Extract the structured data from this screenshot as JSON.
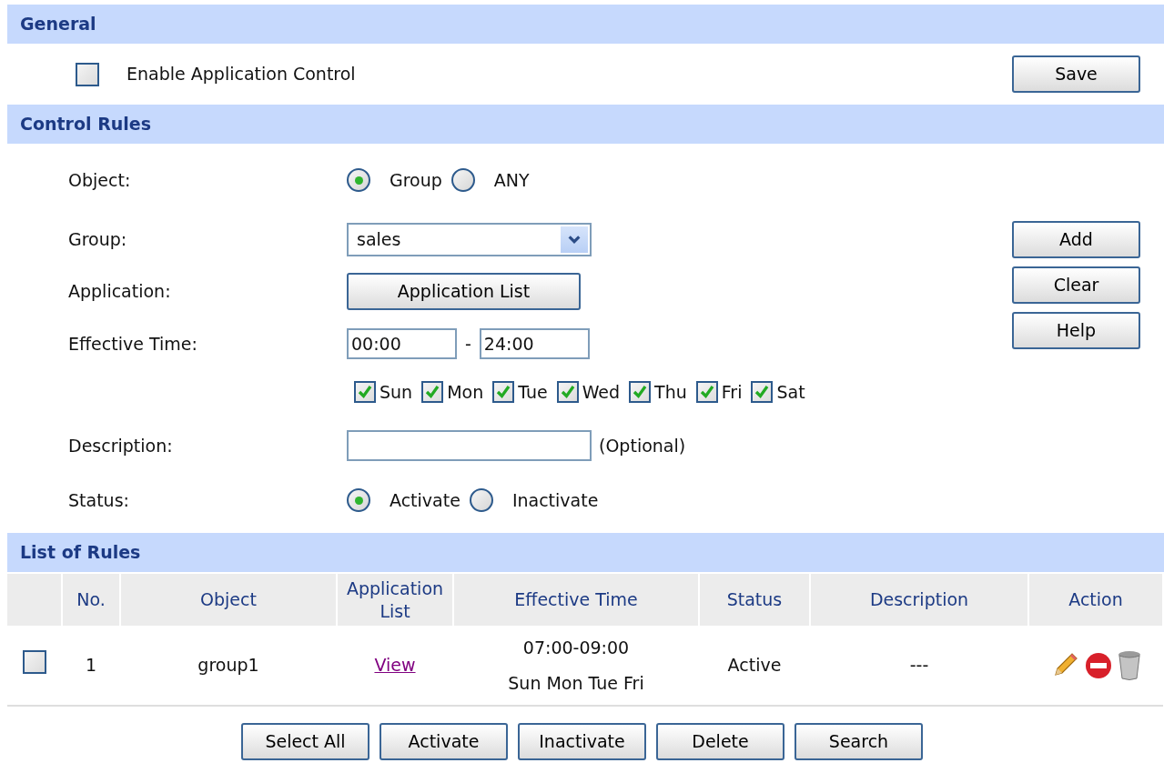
{
  "general": {
    "title": "General",
    "enable": {
      "label": "Enable Application Control",
      "checked": false
    },
    "save_button": "Save"
  },
  "control_rules": {
    "title": "Control Rules",
    "object": {
      "label": "Object:",
      "options": [
        {
          "label": "Group",
          "selected": true
        },
        {
          "label": "ANY",
          "selected": false
        }
      ]
    },
    "group": {
      "label": "Group:",
      "value": "sales"
    },
    "application": {
      "label": "Application:",
      "button": "Application List"
    },
    "effective_time": {
      "label": "Effective Time:",
      "start": "00:00",
      "separator": "-",
      "end": "24:00"
    },
    "days": [
      {
        "label": "Sun",
        "checked": true
      },
      {
        "label": "Mon",
        "checked": true
      },
      {
        "label": "Tue",
        "checked": true
      },
      {
        "label": "Wed",
        "checked": true
      },
      {
        "label": "Thu",
        "checked": true
      },
      {
        "label": "Fri",
        "checked": true
      },
      {
        "label": "Sat",
        "checked": true
      }
    ],
    "description": {
      "label": "Description:",
      "hint": "(Optional)"
    },
    "status": {
      "label": "Status:",
      "options": [
        {
          "label": "Activate",
          "selected": true
        },
        {
          "label": "Inactivate",
          "selected": false
        }
      ]
    },
    "buttons": [
      "Add",
      "Clear",
      "Help"
    ]
  },
  "list_of_rules": {
    "title": "List of Rules",
    "columns": [
      "No.",
      "Object",
      "Application List",
      "Effective Time",
      "Status",
      "Description",
      "Action"
    ],
    "rows": [
      {
        "checked": false,
        "no": "1",
        "object": "group1",
        "application_list": "View",
        "time": "07:00-09:00",
        "days": "Sun Mon Tue Fri",
        "status": "Active",
        "description": "---"
      }
    ],
    "buttons": [
      "Select All",
      "Activate",
      "Inactivate",
      "Delete",
      "Search"
    ]
  }
}
